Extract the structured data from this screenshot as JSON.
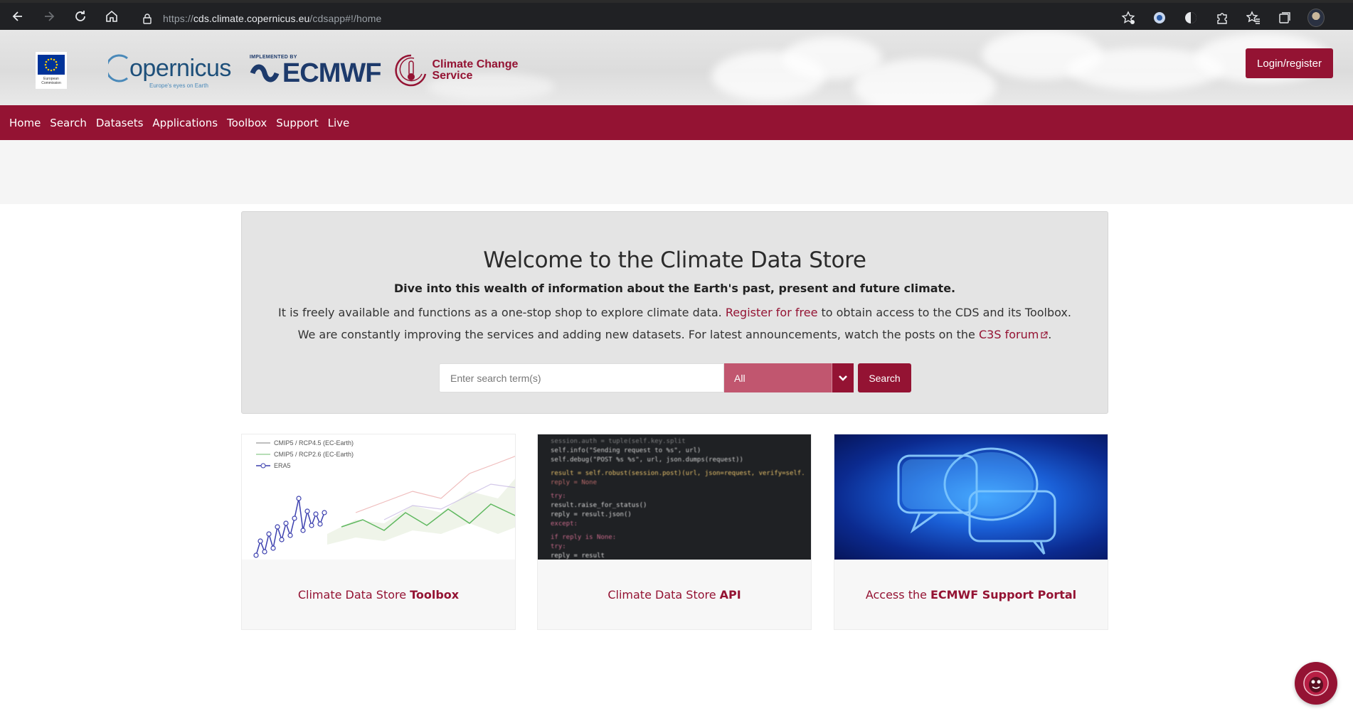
{
  "browser": {
    "url_scheme": "https://",
    "url_host": "cds.climate.copernicus.eu",
    "url_path": "/cdsapp#!/home"
  },
  "header": {
    "eu_label": "European Commission",
    "copernicus_name": "opernicus",
    "copernicus_tagline": "Europe's eyes on Earth",
    "ecmwf_implemented": "IMPLEMENTED BY",
    "ecmwf_name": "ECMWF",
    "c3s_line1": "Climate Change",
    "c3s_line2": "Service",
    "login_label": "Login/register"
  },
  "nav": {
    "items": [
      "Home",
      "Search",
      "Datasets",
      "Applications",
      "Toolbox",
      "Support",
      "Live"
    ]
  },
  "welcome": {
    "title": "Welcome to the Climate Data Store",
    "tagline": "Dive into this wealth of information about the Earth's past, present and future climate.",
    "para1_before": "It is freely available and functions as a one-stop shop to explore climate data. ",
    "para1_link": "Register for free",
    "para1_after": " to obtain access to the CDS and its Toolbox.",
    "para2_before": "We are constantly improving the services and adding new datasets. For latest announcements, watch the posts on the ",
    "para2_link": "C3S forum",
    "para2_after": "."
  },
  "search": {
    "placeholder": "Enter search term(s)",
    "value": "",
    "scope_selected": "All",
    "button_label": "Search"
  },
  "cards": [
    {
      "caption_prefix": "Climate Data Store",
      "caption_bold": "Toolbox",
      "legend": [
        "CMIP5 / RCP4.5 (EC-Earth)",
        "CMIP5 / RCP2.6 (EC-Earth)",
        "ERA5"
      ]
    },
    {
      "caption_prefix": "Climate Data Store",
      "caption_bold": "API",
      "code_lines": [
        "session.auth = tuple(self.key.split",
        "self.info(\"Sending request to %s\", url)",
        "self.debug(\"POST %s %s\", url, json.dumps(request))",
        "result = self.robust(session.post)(url, json=request, verify=self.",
        "reply = None",
        "try:",
        "    result.raise_for_status()",
        "    reply = result.json()",
        "except:",
        "    if reply is None:",
        "        try:",
        "            reply = result"
      ]
    },
    {
      "caption_prefix": "Access the",
      "caption_bold": "ECMWF Support Portal"
    }
  ],
  "colors": {
    "brand": "#941333",
    "select_bg": "#c1566f",
    "panel_bg": "#e4e4e4"
  },
  "icons": [
    "back-icon",
    "forward-icon",
    "reload-icon",
    "home-icon",
    "lock-icon",
    "favorite-add-icon",
    "extension-icon",
    "favorites-icon",
    "collections-icon",
    "profile-avatar",
    "external-link-icon",
    "chevron-down-icon",
    "chat-assistant-icon"
  ]
}
